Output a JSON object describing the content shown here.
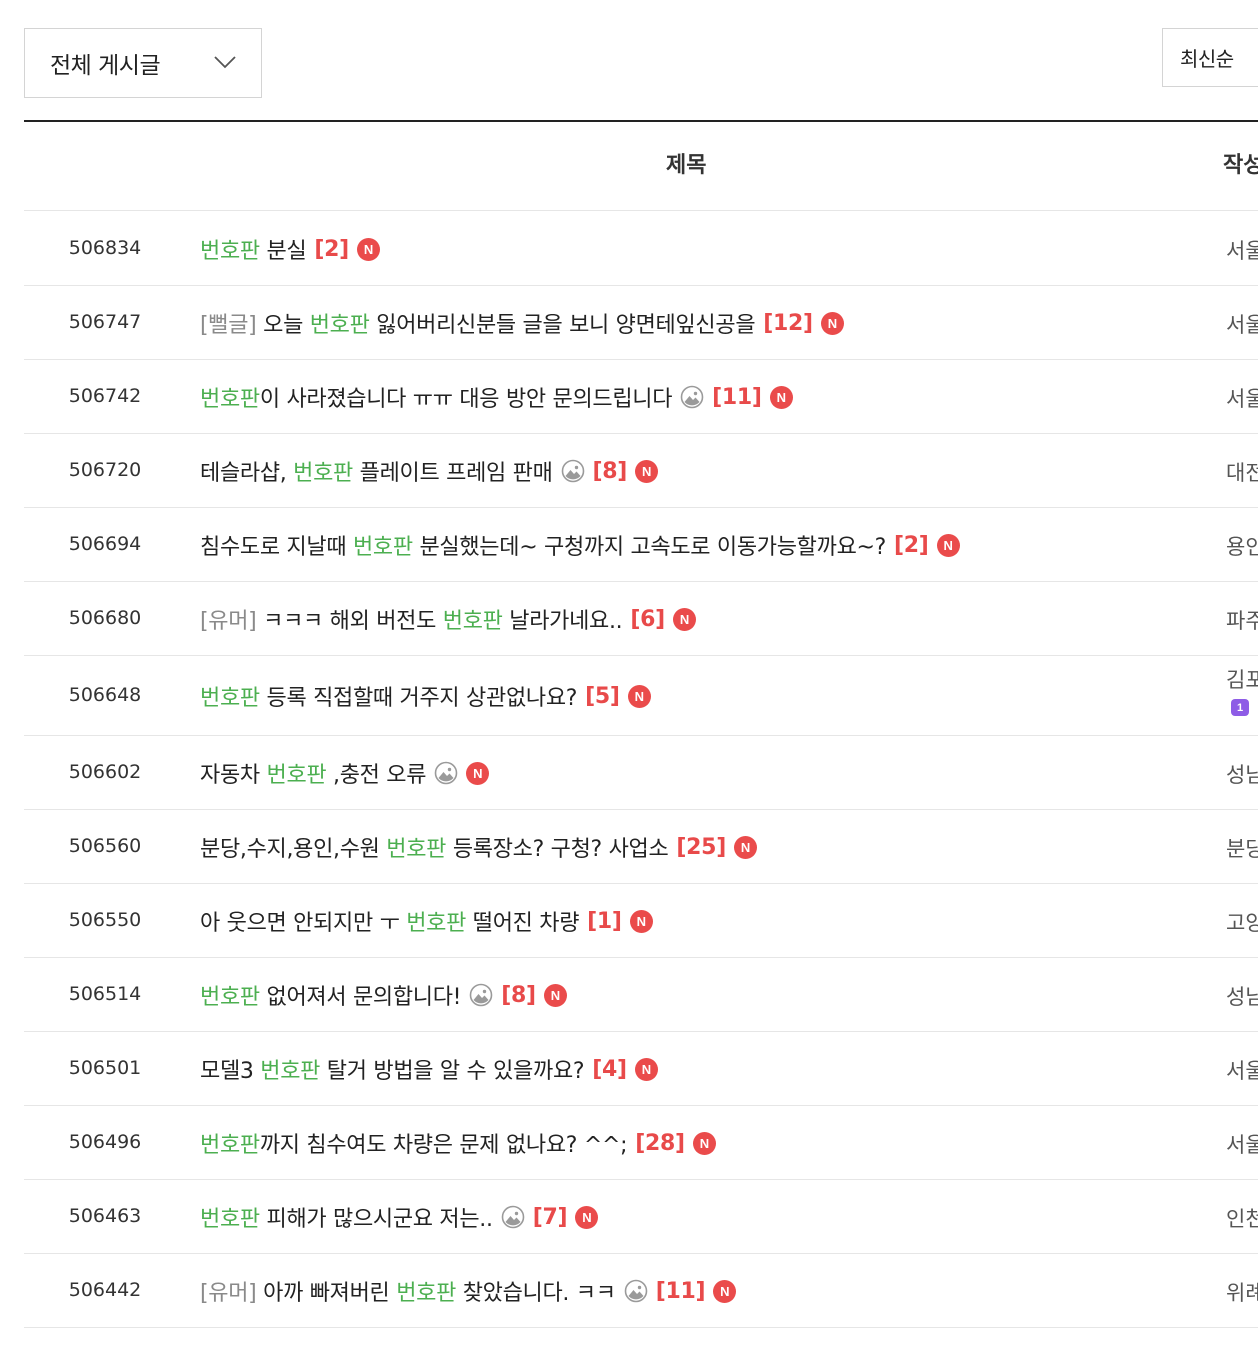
{
  "filter": {
    "label": "전체 게시글",
    "icon": "chevron-down-icon"
  },
  "sort": {
    "label": "최신순"
  },
  "table": {
    "headers": {
      "title": "제목",
      "author": "작성"
    }
  },
  "colors": {
    "keyword": "#4caf50",
    "comment_count": "#e84a4a",
    "new_badge": "#ea4b4b",
    "category": "#8a8a8a"
  },
  "posts": [
    {
      "num": "506834",
      "parts": [
        {
          "k": "kw",
          "t": "번호판"
        },
        {
          "k": "n",
          "t": " 분실"
        }
      ],
      "comments": "[2]",
      "image": false,
      "new": "N",
      "author": "서울"
    },
    {
      "num": "506747",
      "parts": [
        {
          "k": "cat",
          "t": "[뻘글]"
        },
        {
          "k": "n",
          "t": " 오늘 "
        },
        {
          "k": "kw",
          "t": "번호판"
        },
        {
          "k": "n",
          "t": " 잃어버리신분들 글을 보니 양면테잎신공을"
        }
      ],
      "comments": "[12]",
      "image": false,
      "new": "N",
      "author": "서울"
    },
    {
      "num": "506742",
      "parts": [
        {
          "k": "kw",
          "t": "번호판"
        },
        {
          "k": "n",
          "t": "이 사라졌습니다 ㅠㅠ 대응 방안 문의드립니다"
        }
      ],
      "comments": "[11]",
      "image": true,
      "new": "N",
      "author": "서울"
    },
    {
      "num": "506720",
      "parts": [
        {
          "k": "n",
          "t": "테슬라샵, "
        },
        {
          "k": "kw",
          "t": "번호판"
        },
        {
          "k": "n",
          "t": " 플레이트 프레임 판매"
        }
      ],
      "comments": "[8]",
      "image": true,
      "new": "N",
      "author": "대전"
    },
    {
      "num": "506694",
      "parts": [
        {
          "k": "n",
          "t": "침수도로 지날때 "
        },
        {
          "k": "kw",
          "t": "번호판"
        },
        {
          "k": "n",
          "t": " 분실했는데~ 구청까지 고속도로 이동가능할까요~?"
        }
      ],
      "comments": "[2]",
      "image": false,
      "new": "N",
      "author": "용인"
    },
    {
      "num": "506680",
      "parts": [
        {
          "k": "cat",
          "t": "[유머]"
        },
        {
          "k": "n",
          "t": " ㅋㅋㅋ 해외 버전도 "
        },
        {
          "k": "kw",
          "t": "번호판"
        },
        {
          "k": "n",
          "t": " 날라가네요.."
        }
      ],
      "comments": "[6]",
      "image": false,
      "new": "N",
      "author": "파주"
    },
    {
      "num": "506648",
      "parts": [
        {
          "k": "kw",
          "t": "번호판"
        },
        {
          "k": "n",
          "t": " 등록 직접할때 거주지 상관없나요?"
        }
      ],
      "comments": "[5]",
      "image": false,
      "new": "N",
      "author": "김포",
      "level": "1"
    },
    {
      "num": "506602",
      "parts": [
        {
          "k": "n",
          "t": "자동차 "
        },
        {
          "k": "kw",
          "t": "번호판"
        },
        {
          "k": "n",
          "t": " ,충전 오류"
        }
      ],
      "comments": "",
      "image": true,
      "new": "N",
      "author": "성남"
    },
    {
      "num": "506560",
      "parts": [
        {
          "k": "n",
          "t": "분당,수지,용인,수원 "
        },
        {
          "k": "kw",
          "t": "번호판"
        },
        {
          "k": "n",
          "t": " 등록장소? 구청? 사업소"
        }
      ],
      "comments": "[25]",
      "image": false,
      "new": "N",
      "author": "분당"
    },
    {
      "num": "506550",
      "parts": [
        {
          "k": "n",
          "t": "아 웃으면 안되지만 ㅜ "
        },
        {
          "k": "kw",
          "t": "번호판"
        },
        {
          "k": "n",
          "t": " 떨어진 차량"
        }
      ],
      "comments": "[1]",
      "image": false,
      "new": "N",
      "author": "고양"
    },
    {
      "num": "506514",
      "parts": [
        {
          "k": "kw",
          "t": "번호판"
        },
        {
          "k": "n",
          "t": " 없어져서 문의합니다!"
        }
      ],
      "comments": "[8]",
      "image": true,
      "new": "N",
      "author": "성남"
    },
    {
      "num": "506501",
      "parts": [
        {
          "k": "n",
          "t": "모델3 "
        },
        {
          "k": "kw",
          "t": "번호판"
        },
        {
          "k": "n",
          "t": " 탈거 방법을 알 수 있을까요?"
        }
      ],
      "comments": "[4]",
      "image": false,
      "new": "N",
      "author": "서울"
    },
    {
      "num": "506496",
      "parts": [
        {
          "k": "kw",
          "t": "번호판"
        },
        {
          "k": "n",
          "t": "까지 침수여도 차량은 문제 없나요? ^^;"
        }
      ],
      "comments": "[28]",
      "image": false,
      "new": "N",
      "author": "서울"
    },
    {
      "num": "506463",
      "parts": [
        {
          "k": "kw",
          "t": "번호판"
        },
        {
          "k": "n",
          "t": " 피해가 많으시군요 저는.."
        }
      ],
      "comments": "[7]",
      "image": true,
      "new": "N",
      "author": "인천"
    },
    {
      "num": "506442",
      "parts": [
        {
          "k": "cat",
          "t": "[유머]"
        },
        {
          "k": "n",
          "t": " 아까 빠져버린 "
        },
        {
          "k": "kw",
          "t": "번호판"
        },
        {
          "k": "n",
          "t": " 찾았습니다. ㅋㅋ"
        }
      ],
      "comments": "[11]",
      "image": true,
      "new": "N",
      "author": "위례"
    }
  ]
}
